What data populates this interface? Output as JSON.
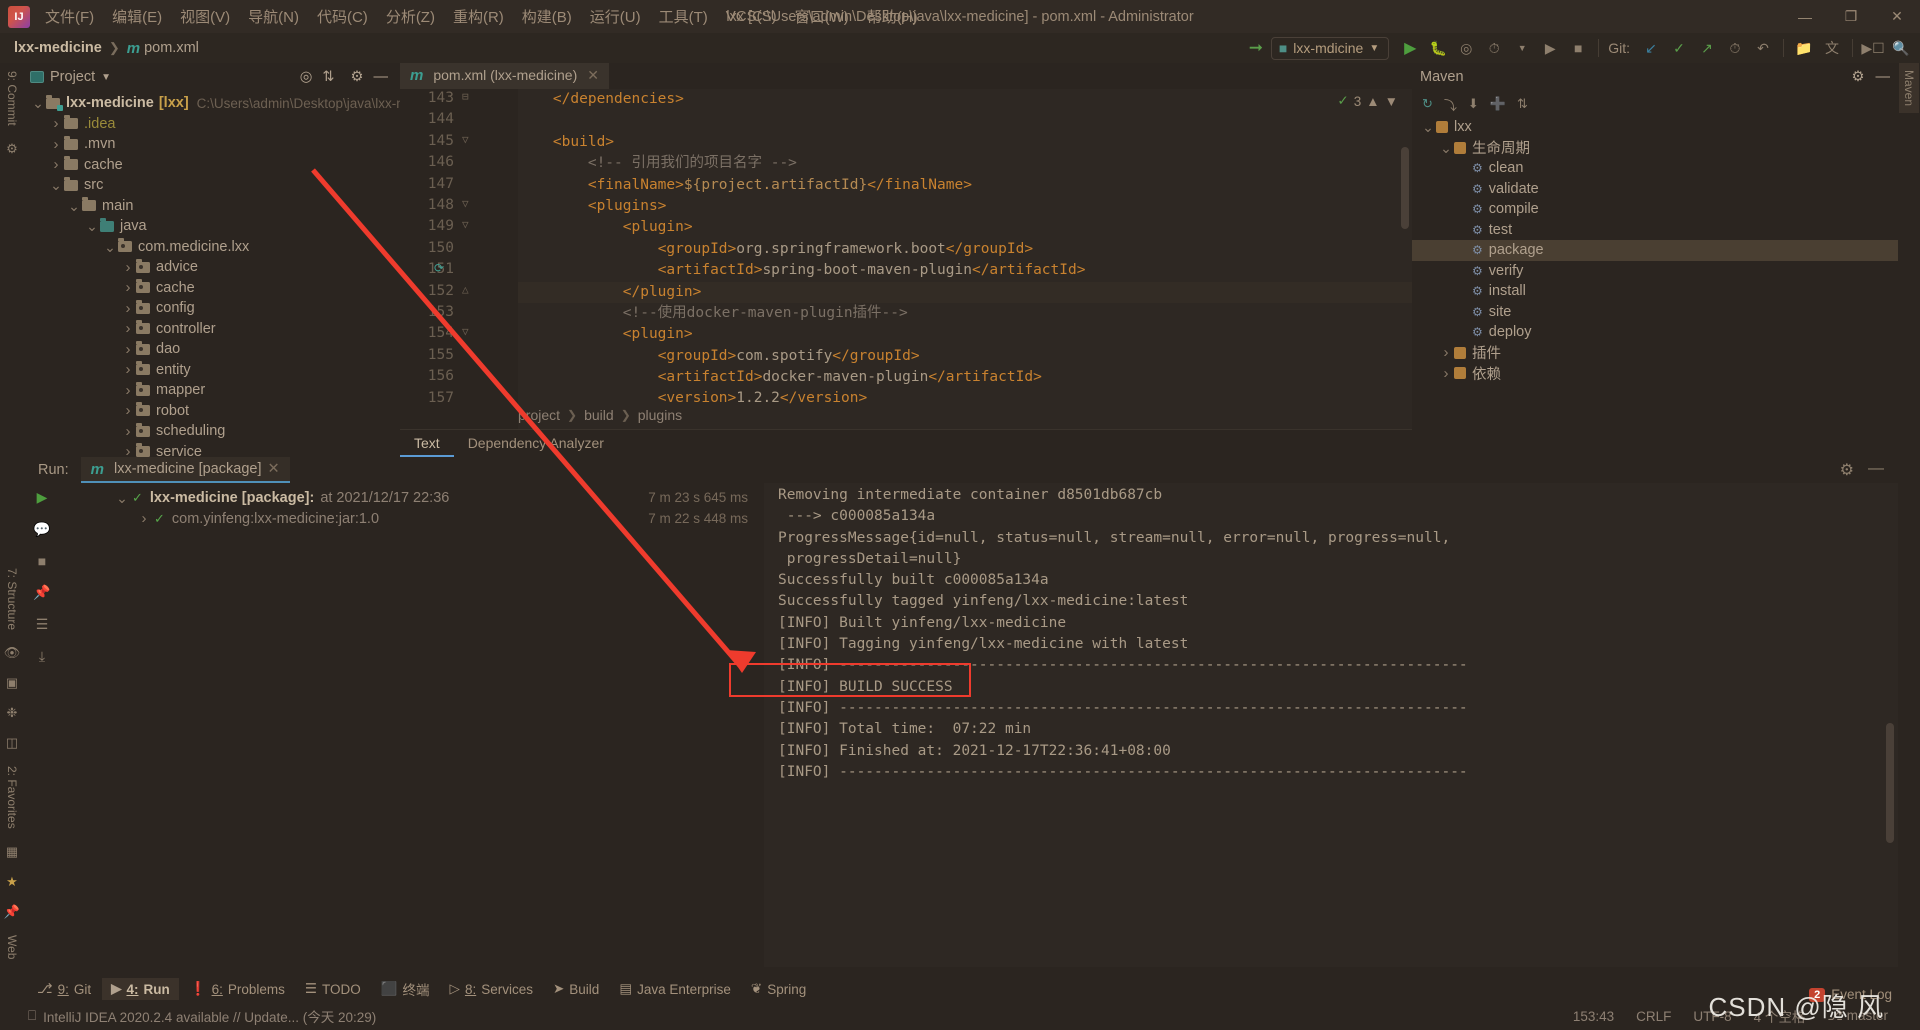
{
  "titlebar": {
    "logo": "idea-logo",
    "menus": [
      "文件(F)",
      "编辑(E)",
      "视图(V)",
      "导航(N)",
      "代码(C)",
      "分析(Z)",
      "重构(R)",
      "构建(B)",
      "运行(U)",
      "工具(T)",
      "VCS(S)",
      "窗口(W)",
      "帮助(H)"
    ],
    "window_title": "lxx [C:\\Users\\admin\\Desktop\\java\\lxx-medicine] - pom.xml - Administrator",
    "minimize": "—",
    "maximize": "❐",
    "close": "✕"
  },
  "navbar": {
    "crumb_project": "lxx-medicine",
    "crumb_file": "pom.xml",
    "m_icon": "m",
    "run_config": "lxx-mdicine",
    "git_label": "Git:"
  },
  "left_stripe": {
    "commit": "9: Commit",
    "structure": "7: Structure",
    "favorites": "2: Favorites",
    "web": "Web"
  },
  "project": {
    "title": "Project",
    "tree": [
      {
        "depth": 0,
        "arrow": "v",
        "icon": "module",
        "label": "lxx-medicine",
        "module": "[lxx]",
        "path": "C:\\Users\\admin\\Desktop\\java\\lxx-me"
      },
      {
        "depth": 1,
        "arrow": ">",
        "icon": "folder-idea",
        "label": ".idea",
        "module": "",
        "path": ""
      },
      {
        "depth": 1,
        "arrow": ">",
        "icon": "folder",
        "label": ".mvn",
        "module": "",
        "path": ""
      },
      {
        "depth": 1,
        "arrow": ">",
        "icon": "folder",
        "label": "cache",
        "module": "",
        "path": ""
      },
      {
        "depth": 1,
        "arrow": "v",
        "icon": "folder",
        "label": "src",
        "module": "",
        "path": ""
      },
      {
        "depth": 2,
        "arrow": "v",
        "icon": "folder",
        "label": "main",
        "module": "",
        "path": ""
      },
      {
        "depth": 3,
        "arrow": "v",
        "icon": "folder-src",
        "label": "java",
        "module": "",
        "path": ""
      },
      {
        "depth": 4,
        "arrow": "v",
        "icon": "folder-pkg",
        "label": "com.medicine.lxx",
        "module": "",
        "path": ""
      },
      {
        "depth": 5,
        "arrow": ">",
        "icon": "folder-pkg",
        "label": "advice",
        "module": "",
        "path": ""
      },
      {
        "depth": 5,
        "arrow": ">",
        "icon": "folder-pkg",
        "label": "cache",
        "module": "",
        "path": ""
      },
      {
        "depth": 5,
        "arrow": ">",
        "icon": "folder-pkg",
        "label": "config",
        "module": "",
        "path": ""
      },
      {
        "depth": 5,
        "arrow": ">",
        "icon": "folder-pkg",
        "label": "controller",
        "module": "",
        "path": ""
      },
      {
        "depth": 5,
        "arrow": ">",
        "icon": "folder-pkg",
        "label": "dao",
        "module": "",
        "path": ""
      },
      {
        "depth": 5,
        "arrow": ">",
        "icon": "folder-pkg",
        "label": "entity",
        "module": "",
        "path": ""
      },
      {
        "depth": 5,
        "arrow": ">",
        "icon": "folder-pkg",
        "label": "mapper",
        "module": "",
        "path": ""
      },
      {
        "depth": 5,
        "arrow": ">",
        "icon": "folder-pkg",
        "label": "robot",
        "module": "",
        "path": ""
      },
      {
        "depth": 5,
        "arrow": ">",
        "icon": "folder-pkg",
        "label": "scheduling",
        "module": "",
        "path": ""
      },
      {
        "depth": 5,
        "arrow": ">",
        "icon": "folder-pkg",
        "label": "service",
        "module": "",
        "path": ""
      }
    ]
  },
  "editor": {
    "tab_label": "pom.xml (lxx-medicine)",
    "tab_icon": "m",
    "inspection_count": "3",
    "lines": [
      {
        "num": "143",
        "fold": "-",
        "gmark": "",
        "code": "    </dependencies>"
      },
      {
        "num": "144",
        "fold": "",
        "gmark": "",
        "code": ""
      },
      {
        "num": "145",
        "fold": "v",
        "gmark": "",
        "code": "    <build>"
      },
      {
        "num": "146",
        "fold": "",
        "gmark": "",
        "code": "        <!-- 引用我们的项目名字 -->"
      },
      {
        "num": "147",
        "fold": "",
        "gmark": "",
        "code": "        <finalName>${project.artifactId}</finalName>"
      },
      {
        "num": "148",
        "fold": "v",
        "gmark": "",
        "code": "        <plugins>"
      },
      {
        "num": "149",
        "fold": "v",
        "gmark": "",
        "code": "            <plugin>"
      },
      {
        "num": "150",
        "fold": "",
        "gmark": "",
        "code": "                <groupId>org.springframework.boot</groupId>"
      },
      {
        "num": "151",
        "fold": "",
        "gmark": "tag",
        "code": "                <artifactId>spring-boot-maven-plugin</artifactId>"
      },
      {
        "num": "152",
        "fold": "^",
        "gmark": "",
        "code": "            </plugin>"
      },
      {
        "num": "153",
        "fold": "",
        "gmark": "",
        "code": "            <!--使用docker-maven-plugin插件-->"
      },
      {
        "num": "154",
        "fold": "v",
        "gmark": "",
        "code": "            <plugin>"
      },
      {
        "num": "155",
        "fold": "",
        "gmark": "",
        "code": "                <groupId>com.spotify</groupId>"
      },
      {
        "num": "156",
        "fold": "",
        "gmark": "",
        "code": "                <artifactId>docker-maven-plugin</artifactId>"
      },
      {
        "num": "157",
        "fold": "",
        "gmark": "",
        "code": "                <version>1.2.2</version>"
      }
    ],
    "breadcrumb": [
      "project",
      "build",
      "plugins"
    ],
    "bottom_tabs": [
      {
        "label": "Text",
        "active": true
      },
      {
        "label": "Dependency Analyzer",
        "active": false
      }
    ]
  },
  "maven": {
    "title": "Maven",
    "tree": [
      {
        "depth": 0,
        "arrow": "v",
        "icon": "cube",
        "label": "lxx",
        "selected": false
      },
      {
        "depth": 1,
        "arrow": "v",
        "icon": "cube",
        "label": "生命周期",
        "selected": false
      },
      {
        "depth": 2,
        "arrow": "",
        "icon": "gear",
        "label": "clean",
        "selected": false
      },
      {
        "depth": 2,
        "arrow": "",
        "icon": "gear",
        "label": "validate",
        "selected": false
      },
      {
        "depth": 2,
        "arrow": "",
        "icon": "gear",
        "label": "compile",
        "selected": false
      },
      {
        "depth": 2,
        "arrow": "",
        "icon": "gear",
        "label": "test",
        "selected": false
      },
      {
        "depth": 2,
        "arrow": "",
        "icon": "gear",
        "label": "package",
        "selected": true
      },
      {
        "depth": 2,
        "arrow": "",
        "icon": "gear",
        "label": "verify",
        "selected": false
      },
      {
        "depth": 2,
        "arrow": "",
        "icon": "gear",
        "label": "install",
        "selected": false
      },
      {
        "depth": 2,
        "arrow": "",
        "icon": "gear",
        "label": "site",
        "selected": false
      },
      {
        "depth": 2,
        "arrow": "",
        "icon": "gear",
        "label": "deploy",
        "selected": false
      },
      {
        "depth": 1,
        "arrow": ">",
        "icon": "cube",
        "label": "插件",
        "selected": false
      },
      {
        "depth": 1,
        "arrow": ">",
        "icon": "cube",
        "label": "依赖",
        "selected": false
      }
    ]
  },
  "right_stripe": {
    "maven": "Maven"
  },
  "run": {
    "label": "Run:",
    "tab_label": "lxx-medicine [package]",
    "tab_icon": "m",
    "tree": [
      {
        "depth": 0,
        "arrow": "v",
        "label": "lxx-medicine [package]:",
        "suffix": "at 2021/12/17 22:36",
        "time": "7 m 23 s 645 ms",
        "bold": true
      },
      {
        "depth": 1,
        "arrow": ">",
        "label": "com.yinfeng:lxx-medicine:jar:1.0",
        "suffix": "",
        "time": "7 m 22 s 448 ms",
        "bold": false
      }
    ],
    "console": [
      "Removing intermediate container d8501db687cb",
      " ---> c000085a134a",
      "ProgressMessage{id=null, status=null, stream=null, error=null, progress=null,",
      " progressDetail=null}",
      "Successfully built c000085a134a",
      "Successfully tagged yinfeng/lxx-medicine:latest",
      "[INFO] Built yinfeng/lxx-medicine",
      "[INFO] Tagging yinfeng/lxx-medicine with latest",
      "[INFO] ------------------------------------------------------------------------",
      "[INFO] BUILD SUCCESS",
      "[INFO] ------------------------------------------------------------------------",
      "[INFO] Total time:  07:22 min",
      "[INFO] Finished at: 2021-12-17T22:36:41+08:00",
      "[INFO] ------------------------------------------------------------------------"
    ],
    "highlight_text": "BUILD SUCCESS",
    "highlight_color": "#ef3b2d"
  },
  "tool_tabs": [
    {
      "num": "9",
      "label": "Git",
      "icon": "git-icon",
      "active": false
    },
    {
      "num": "4",
      "label": "Run",
      "icon": "run-icon",
      "active": true
    },
    {
      "num": "6",
      "label": "Problems",
      "icon": "problems-icon",
      "active": false
    },
    {
      "num": "",
      "label": "TODO",
      "icon": "todo-icon",
      "active": false
    },
    {
      "num": "",
      "label": "终端",
      "icon": "terminal-icon",
      "active": false
    },
    {
      "num": "8",
      "label": "Services",
      "icon": "services-icon",
      "active": false
    },
    {
      "num": "",
      "label": "Build",
      "icon": "build-icon",
      "active": false
    },
    {
      "num": "",
      "label": "Java Enterprise",
      "icon": "java-enterprise-icon",
      "active": false
    },
    {
      "num": "",
      "label": "Spring",
      "icon": "spring-icon",
      "active": false
    }
  ],
  "statusbar": {
    "message": "IntelliJ IDEA 2020.2.4 available // Update... (今天 20:29)",
    "caret": "153:43",
    "line_sep": "CRLF",
    "encoding": "UTF-8",
    "indent": "4 个空格",
    "branch": "master",
    "event_log": "Event Log",
    "event_count": "2"
  },
  "watermark": "CSDN @隐 风"
}
